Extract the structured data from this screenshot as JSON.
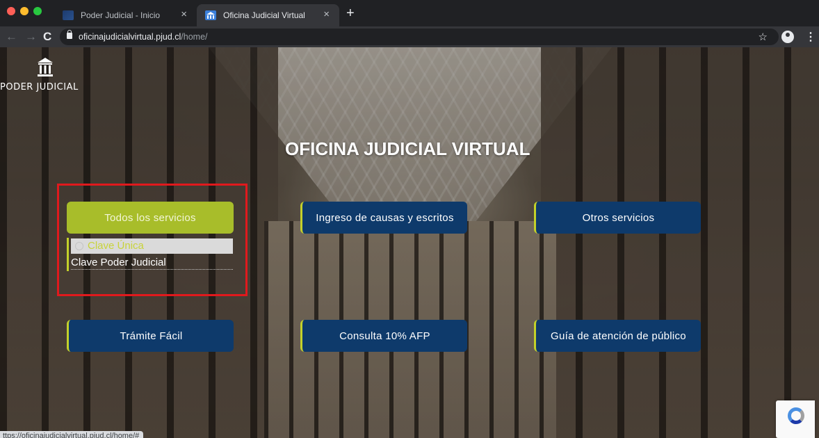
{
  "browser": {
    "tabs": [
      {
        "title": "Poder Judicial - Inicio",
        "active": false
      },
      {
        "title": "Oficina Judicial Virtual",
        "active": true
      }
    ],
    "new_tab": "+",
    "close_glyph": "×",
    "url_host": "oficinajudicialvirtual.pjud.cl",
    "url_path": "/home/",
    "status_url": "ttps://oficinajudicialvirtual.pjud.cl/home/#"
  },
  "site": {
    "brand": "PODER JUDICIAL",
    "title": "OFICINA JUDICIAL VIRTUAL"
  },
  "buttons": {
    "todos": "Todos los servicios",
    "ingreso": "Ingreso de causas y escritos",
    "otros": "Otros servicios",
    "tramite": "Trámite Fácil",
    "consulta": "Consulta 10% AFP",
    "guia": "Guía de atención de público"
  },
  "dropdown": {
    "items": [
      "Clave Única",
      "Clave Poder Judicial"
    ]
  },
  "colors": {
    "button_blue": "#0e3a6b",
    "accent_green": "#a8bd2a",
    "highlight_red": "#e0191d"
  }
}
